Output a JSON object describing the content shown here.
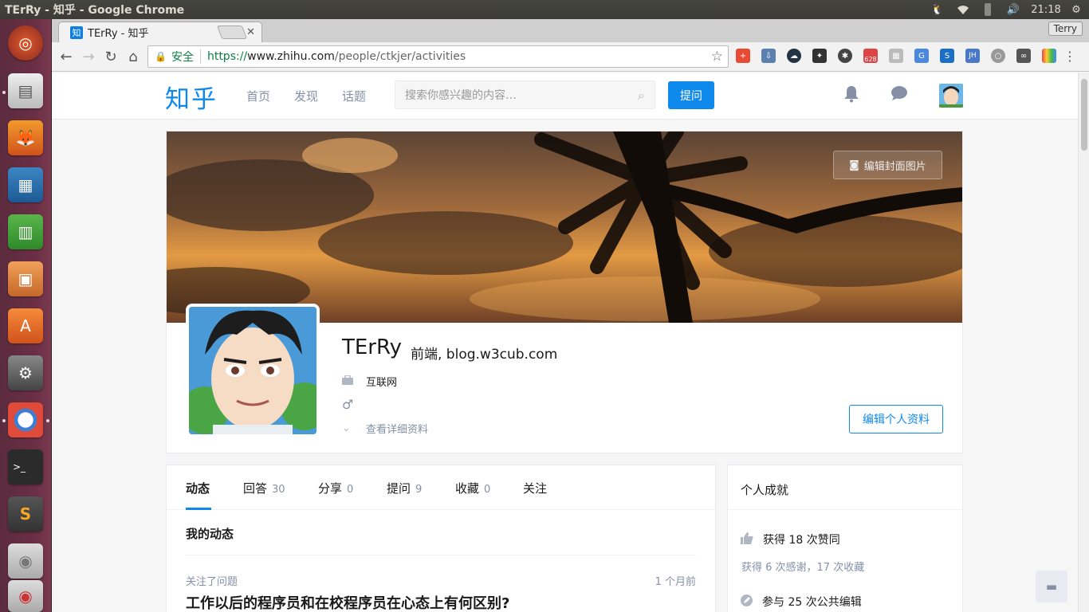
{
  "os": {
    "window_title": "TErRy - 知乎 - Google Chrome",
    "clock": "21:18"
  },
  "browser": {
    "tab_title": "TErRy - 知乎",
    "favicon_text": "知",
    "user_badge": "Terry",
    "secure_label": "安全",
    "url_scheme": "https://",
    "url_host": "www.zhihu.com",
    "url_path": "/people/ctkjer/activities",
    "ext_badge": "628",
    "ext_jh": "JH"
  },
  "nav": {
    "logo": "知乎",
    "links": [
      "首页",
      "发现",
      "话题"
    ],
    "search_placeholder": "搜索你感兴趣的内容…",
    "ask_button": "提问"
  },
  "profile": {
    "edit_cover": "编辑封面图片",
    "name": "TErRy",
    "headline": "前端, blog.w3cub.com",
    "industry": "互联网",
    "gender_symbol": "♂",
    "more_info": "查看详细资料",
    "edit_profile": "编辑个人资料"
  },
  "activity": {
    "tabs": [
      {
        "label": "动态",
        "count": ""
      },
      {
        "label": "回答",
        "count": "30"
      },
      {
        "label": "分享",
        "count": "0"
      },
      {
        "label": "提问",
        "count": "9"
      },
      {
        "label": "收藏",
        "count": "0"
      },
      {
        "label": "关注",
        "count": ""
      }
    ],
    "section_title": "我的动态",
    "feed": [
      {
        "meta": "关注了问题",
        "time": "1 个月前",
        "title": "工作以后的程序员和在校程序员在心态上有何区别?"
      }
    ]
  },
  "achievements": {
    "title": "个人成就",
    "likes": "获得 18 次赞同",
    "thanks": "获得 6 次感谢，17 次收藏",
    "edits": "参与 25 次公共编辑"
  },
  "colors": {
    "brand": "#0f88eb",
    "launcher": "#6b2f45",
    "secure_green": "#0b8043"
  }
}
